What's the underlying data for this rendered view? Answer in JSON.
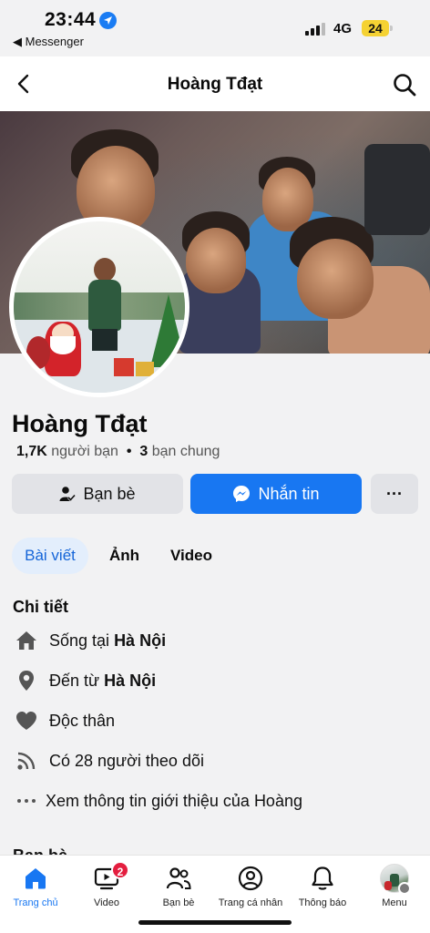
{
  "status_bar": {
    "time": "23:44",
    "back_app": "◀ Messenger",
    "network": "4G",
    "battery": "24"
  },
  "header": {
    "title": "Hoàng Tđạt"
  },
  "profile": {
    "name": "Hoàng Tđạt",
    "friends_count": "1,7K",
    "friends_label": "người bạn",
    "separator": "•",
    "mutual_count": "3",
    "mutual_label": "bạn chung"
  },
  "actions": {
    "friends_button": "Bạn bè",
    "message_button": "Nhắn tin",
    "more_button": "···"
  },
  "tabs": [
    {
      "label": "Bài viết",
      "active": true
    },
    {
      "label": "Ảnh",
      "active": false
    },
    {
      "label": "Video",
      "active": false
    }
  ],
  "details": {
    "title": "Chi tiết",
    "lives_prefix": "Sống tại",
    "lives_place": "Hà Nội",
    "from_prefix": "Đến từ",
    "from_place": "Hà Nội",
    "relationship": "Độc thân",
    "followers": "Có 28 người theo dõi",
    "see_about": "Xem thông tin giới thiệu của Hoàng"
  },
  "friends_section": {
    "title": "Bạn bè"
  },
  "bottom_nav": [
    {
      "label": "Trang chủ",
      "icon": "home-icon",
      "active": true
    },
    {
      "label": "Video",
      "icon": "video-icon",
      "badge": "2"
    },
    {
      "label": "Bạn bè",
      "icon": "friends-icon"
    },
    {
      "label": "Trang cá nhân",
      "icon": "profile-icon"
    },
    {
      "label": "Thông báo",
      "icon": "bell-icon"
    },
    {
      "label": "Menu",
      "icon": "menu-avatar-icon"
    }
  ],
  "colors": {
    "accent": "#1877f2",
    "badge": "#e41e3f",
    "battery": "#f5d233"
  }
}
